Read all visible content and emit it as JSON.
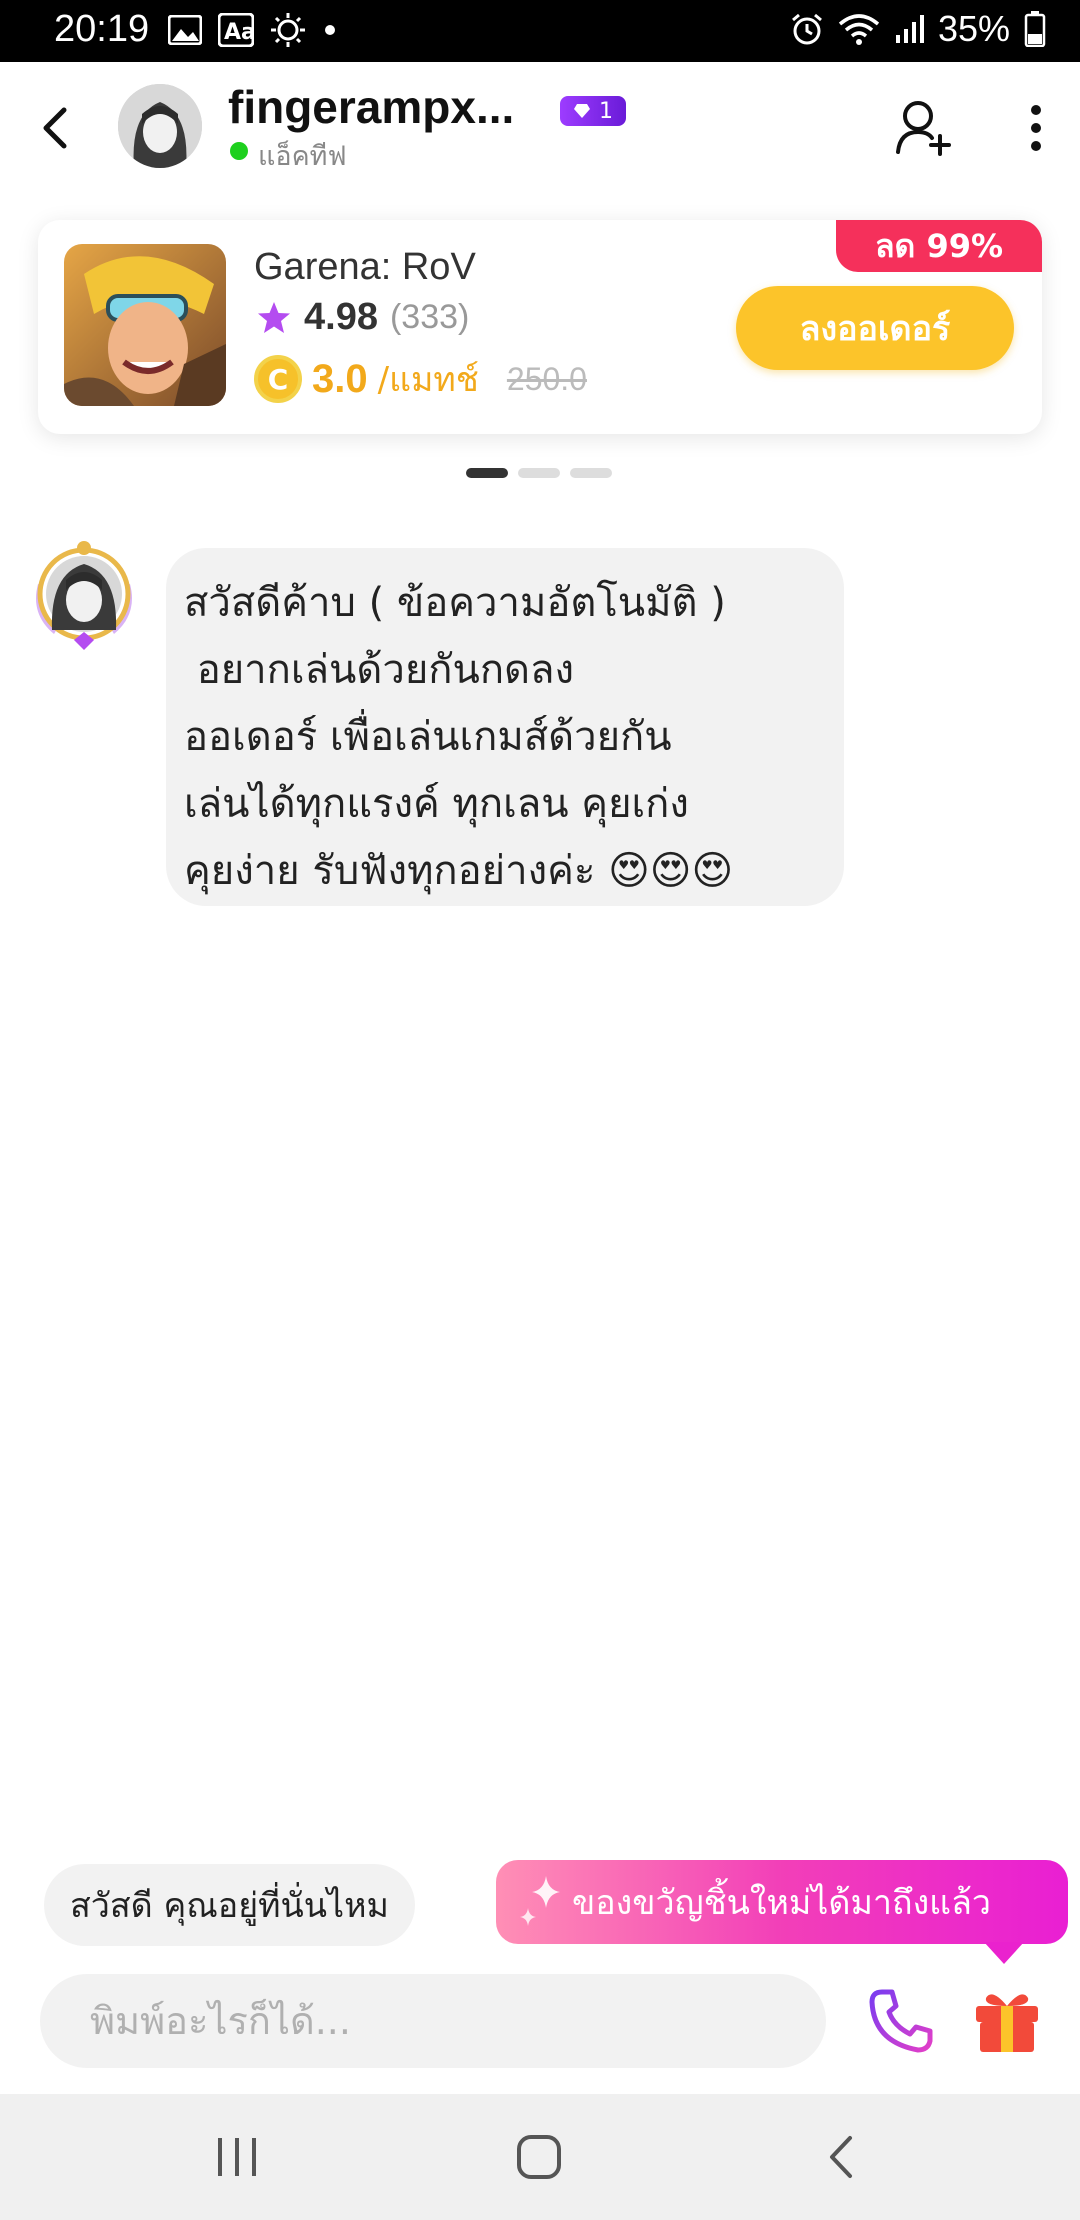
{
  "status_bar": {
    "time": "20:19",
    "battery": "35%",
    "icons": [
      "image-icon",
      "font-icon",
      "brightness-icon",
      "dot-icon",
      "alarm-icon",
      "wifi-icon",
      "signal-icon",
      "battery-icon"
    ]
  },
  "header": {
    "username": "fingerampx...",
    "vip_level": "1",
    "status": "แอ็คทีฟ",
    "online_color": "#1ed01e"
  },
  "product": {
    "game": "Garena: RoV",
    "rating": "4.98",
    "rating_count": "(333)",
    "price": "3.0",
    "price_unit": "/แมทช์",
    "original_price": "250.0",
    "discount": "ลด 99%",
    "order_label": "ลงออเดอร์",
    "accent": "#fcc42a",
    "discount_color": "#f5305b"
  },
  "pager": {
    "count": 3,
    "active_index": 0
  },
  "message": {
    "text": "สวัสดีค้าบ ( ข้อความอัตโนมัติ )\n อยากเล่นด้วยกันกดลง\nออเดอร์ เพื่อเล่นเกมส์ด้วยกัน\nเล่นได้ทุกแรงค์ ทุกเลน คุยเก่ง\nคุยง่าย รับฟังทุกอย่างค่ะ 😍😍😍"
  },
  "quick_reply": "สวัสดี คุณอยู่ที่นั่นไหม",
  "gift_banner": "ของขวัญชิ้นใหม่ได้มาถึงแล้ว",
  "input": {
    "placeholder": "พิมพ์อะไรก็ได้...",
    "value": ""
  },
  "accent_purple": "#9d3cff"
}
